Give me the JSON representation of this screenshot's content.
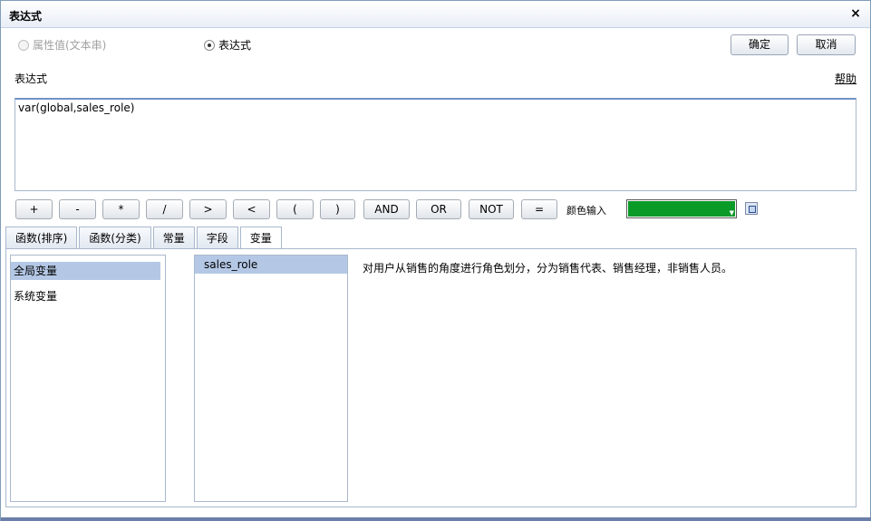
{
  "window": {
    "title": "表达式",
    "close_label": "×"
  },
  "mode": {
    "option_string": "属性值(文本串)",
    "option_expression": "表达式",
    "selected": "expression"
  },
  "actions": {
    "ok_label": "确定",
    "cancel_label": "取消"
  },
  "expression": {
    "label": "表达式",
    "help_label": "帮助",
    "value": "var(global,sales_role)"
  },
  "operators": [
    "+",
    "-",
    "*",
    "/",
    ">",
    "<",
    "(",
    ")",
    "AND",
    "OR",
    "NOT",
    "="
  ],
  "color_input": {
    "label": "颜色输入",
    "value": "#0a9a28"
  },
  "tabs": [
    {
      "label": "函数(排序)"
    },
    {
      "label": "函数(分类)"
    },
    {
      "label": "常量"
    },
    {
      "label": "字段"
    },
    {
      "label": "变量"
    }
  ],
  "active_tab": "变量",
  "categories": [
    "全局变量",
    "系统变量"
  ],
  "selected_category": "全局变量",
  "variables": [
    "sales_role"
  ],
  "selected_variable": "sales_role",
  "description": "对用户从销售的角度进行角色划分，分为销售代表、销售经理，非销售人员。"
}
